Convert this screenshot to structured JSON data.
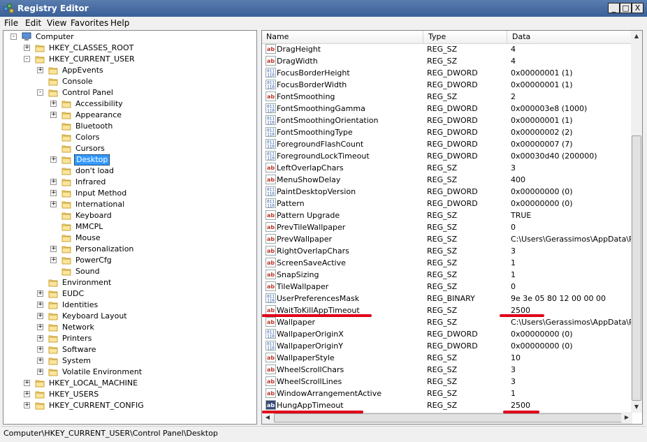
{
  "window": {
    "title": "Registry Editor",
    "min": "_",
    "max": "□",
    "close": "X"
  },
  "menu": [
    "File",
    "Edit",
    "View",
    "Favorites",
    "Help"
  ],
  "tree": [
    {
      "label": "Computer",
      "level": 0,
      "exp": "-",
      "icon": "computer-icon"
    },
    {
      "label": "HKEY_CLASSES_ROOT",
      "level": 1,
      "exp": "+",
      "icon": "folder-icon"
    },
    {
      "label": "HKEY_CURRENT_USER",
      "level": 1,
      "exp": "-",
      "icon": "folder-icon"
    },
    {
      "label": "AppEvents",
      "level": 2,
      "exp": "+",
      "icon": "folder-icon"
    },
    {
      "label": "Console",
      "level": 2,
      "exp": "",
      "icon": "folder-icon"
    },
    {
      "label": "Control Panel",
      "level": 2,
      "exp": "-",
      "icon": "folder-open-icon"
    },
    {
      "label": "Accessibility",
      "level": 3,
      "exp": "+",
      "icon": "folder-icon"
    },
    {
      "label": "Appearance",
      "level": 3,
      "exp": "+",
      "icon": "folder-icon"
    },
    {
      "label": "Bluetooth",
      "level": 3,
      "exp": "",
      "icon": "folder-icon"
    },
    {
      "label": "Colors",
      "level": 3,
      "exp": "",
      "icon": "folder-icon"
    },
    {
      "label": "Cursors",
      "level": 3,
      "exp": "",
      "icon": "folder-icon"
    },
    {
      "label": "Desktop",
      "level": 3,
      "exp": "+",
      "icon": "folder-open-icon",
      "selected": true
    },
    {
      "label": "don't load",
      "level": 3,
      "exp": "",
      "icon": "folder-icon"
    },
    {
      "label": "Infrared",
      "level": 3,
      "exp": "+",
      "icon": "folder-icon"
    },
    {
      "label": "Input Method",
      "level": 3,
      "exp": "+",
      "icon": "folder-icon"
    },
    {
      "label": "International",
      "level": 3,
      "exp": "+",
      "icon": "folder-icon"
    },
    {
      "label": "Keyboard",
      "level": 3,
      "exp": "",
      "icon": "folder-icon"
    },
    {
      "label": "MMCPL",
      "level": 3,
      "exp": "",
      "icon": "folder-icon"
    },
    {
      "label": "Mouse",
      "level": 3,
      "exp": "",
      "icon": "folder-icon"
    },
    {
      "label": "Personalization",
      "level": 3,
      "exp": "+",
      "icon": "folder-icon"
    },
    {
      "label": "PowerCfg",
      "level": 3,
      "exp": "+",
      "icon": "folder-icon"
    },
    {
      "label": "Sound",
      "level": 3,
      "exp": "",
      "icon": "folder-icon"
    },
    {
      "label": "Environment",
      "level": 2,
      "exp": "",
      "icon": "folder-icon"
    },
    {
      "label": "EUDC",
      "level": 2,
      "exp": "+",
      "icon": "folder-icon"
    },
    {
      "label": "Identities",
      "level": 2,
      "exp": "+",
      "icon": "folder-icon"
    },
    {
      "label": "Keyboard Layout",
      "level": 2,
      "exp": "+",
      "icon": "folder-icon"
    },
    {
      "label": "Network",
      "level": 2,
      "exp": "+",
      "icon": "folder-icon"
    },
    {
      "label": "Printers",
      "level": 2,
      "exp": "+",
      "icon": "folder-icon"
    },
    {
      "label": "Software",
      "level": 2,
      "exp": "+",
      "icon": "folder-icon"
    },
    {
      "label": "System",
      "level": 2,
      "exp": "+",
      "icon": "folder-icon"
    },
    {
      "label": "Volatile Environment",
      "level": 2,
      "exp": "+",
      "icon": "folder-icon"
    },
    {
      "label": "HKEY_LOCAL_MACHINE",
      "level": 1,
      "exp": "+",
      "icon": "folder-icon"
    },
    {
      "label": "HKEY_USERS",
      "level": 1,
      "exp": "+",
      "icon": "folder-icon"
    },
    {
      "label": "HKEY_CURRENT_CONFIG",
      "level": 1,
      "exp": "+",
      "icon": "folder-icon"
    }
  ],
  "columns": {
    "name": "Name",
    "type": "Type",
    "data": "Data"
  },
  "values": [
    {
      "name": "DragHeight",
      "type": "REG_SZ",
      "data": "4",
      "icon": "string-value-icon"
    },
    {
      "name": "DragWidth",
      "type": "REG_SZ",
      "data": "4",
      "icon": "string-value-icon"
    },
    {
      "name": "FocusBorderHeight",
      "type": "REG_DWORD",
      "data": "0x00000001 (1)",
      "icon": "binary-value-icon"
    },
    {
      "name": "FocusBorderWidth",
      "type": "REG_DWORD",
      "data": "0x00000001 (1)",
      "icon": "binary-value-icon"
    },
    {
      "name": "FontSmoothing",
      "type": "REG_SZ",
      "data": "2",
      "icon": "string-value-icon"
    },
    {
      "name": "FontSmoothingGamma",
      "type": "REG_DWORD",
      "data": "0x000003e8 (1000)",
      "icon": "binary-value-icon"
    },
    {
      "name": "FontSmoothingOrientation",
      "type": "REG_DWORD",
      "data": "0x00000001 (1)",
      "icon": "binary-value-icon"
    },
    {
      "name": "FontSmoothingType",
      "type": "REG_DWORD",
      "data": "0x00000002 (2)",
      "icon": "binary-value-icon"
    },
    {
      "name": "ForegroundFlashCount",
      "type": "REG_DWORD",
      "data": "0x00000007 (7)",
      "icon": "binary-value-icon"
    },
    {
      "name": "ForegroundLockTimeout",
      "type": "REG_DWORD",
      "data": "0x00030d40 (200000)",
      "icon": "binary-value-icon"
    },
    {
      "name": "LeftOverlapChars",
      "type": "REG_SZ",
      "data": "3",
      "icon": "string-value-icon"
    },
    {
      "name": "MenuShowDelay",
      "type": "REG_SZ",
      "data": "400",
      "icon": "string-value-icon"
    },
    {
      "name": "PaintDesktopVersion",
      "type": "REG_DWORD",
      "data": "0x00000000 (0)",
      "icon": "binary-value-icon"
    },
    {
      "name": "Pattern",
      "type": "REG_DWORD",
      "data": "0x00000000 (0)",
      "icon": "binary-value-icon"
    },
    {
      "name": "Pattern Upgrade",
      "type": "REG_SZ",
      "data": "TRUE",
      "icon": "string-value-icon"
    },
    {
      "name": "PrevTileWallpaper",
      "type": "REG_SZ",
      "data": "0",
      "icon": "string-value-icon"
    },
    {
      "name": "PrevWallpaper",
      "type": "REG_SZ",
      "data": "C:\\Users\\Gerassimos\\AppData\\Roan",
      "icon": "string-value-icon"
    },
    {
      "name": "RightOverlapChars",
      "type": "REG_SZ",
      "data": "3",
      "icon": "string-value-icon"
    },
    {
      "name": "ScreenSaveActive",
      "type": "REG_SZ",
      "data": "1",
      "icon": "string-value-icon"
    },
    {
      "name": "SnapSizing",
      "type": "REG_SZ",
      "data": "1",
      "icon": "string-value-icon"
    },
    {
      "name": "TileWallpaper",
      "type": "REG_SZ",
      "data": "0",
      "icon": "string-value-icon"
    },
    {
      "name": "UserPreferencesMask",
      "type": "REG_BINARY",
      "data": "9e 3e 05 80 12 00 00 00",
      "icon": "binary-value-icon"
    },
    {
      "name": "WaitToKillAppTimeout",
      "type": "REG_SZ",
      "data": "2500",
      "icon": "string-value-icon",
      "underline": true
    },
    {
      "name": "Wallpaper",
      "type": "REG_SZ",
      "data": "C:\\Users\\Gerassimos\\AppData\\Roan",
      "icon": "string-value-icon"
    },
    {
      "name": "WallpaperOriginX",
      "type": "REG_DWORD",
      "data": "0x00000000 (0)",
      "icon": "binary-value-icon"
    },
    {
      "name": "WallpaperOriginY",
      "type": "REG_DWORD",
      "data": "0x00000000 (0)",
      "icon": "binary-value-icon"
    },
    {
      "name": "WallpaperStyle",
      "type": "REG_SZ",
      "data": "10",
      "icon": "string-value-icon"
    },
    {
      "name": "WheelScrollChars",
      "type": "REG_SZ",
      "data": "3",
      "icon": "string-value-icon"
    },
    {
      "name": "WheelScrollLines",
      "type": "REG_SZ",
      "data": "3",
      "icon": "string-value-icon"
    },
    {
      "name": "WindowArrangementActive",
      "type": "REG_SZ",
      "data": "1",
      "icon": "string-value-icon"
    },
    {
      "name": "HungAppTimeout",
      "type": "REG_SZ",
      "data": "2500",
      "icon": "string-value-icon",
      "underline": true,
      "highlight_icon": true
    }
  ],
  "status": {
    "path": "Computer\\HKEY_CURRENT_USER\\Control Panel\\Desktop"
  },
  "colors": {
    "selection": "#3399ff",
    "annotation": "#e0001a"
  }
}
